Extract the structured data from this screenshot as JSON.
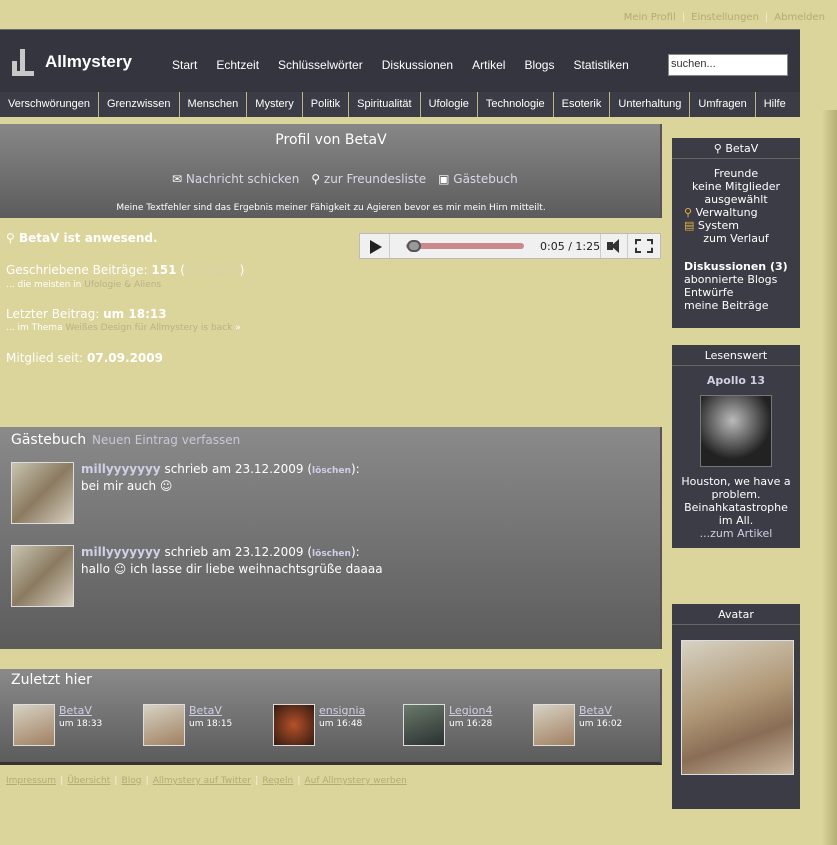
{
  "toplinks": [
    "Mein Profil",
    "Einstellungen",
    "Abmelden"
  ],
  "brand": "Allmystery",
  "mainnav": [
    "Start",
    "Echtzeit",
    "Schlüsselwörter",
    "Diskussionen",
    "Artikel",
    "Blogs",
    "Statistiken"
  ],
  "search": {
    "value": "suchen..."
  },
  "catnav": [
    "Verschwörungen",
    "Grenzwissen",
    "Menschen",
    "Mystery",
    "Politik",
    "Spiritualität",
    "Ufologie",
    "Technologie",
    "Esoterik",
    "Unterhaltung",
    "Umfragen",
    "Hilfe"
  ],
  "profile": {
    "title": "Profil von BetaV",
    "send": "Nachricht schicken",
    "friends": "zur Freundesliste",
    "guestbook": "Gästebuch",
    "motto": "Meine Textfehler sind das Ergebnis meiner Fähigkeit zu Agieren bevor es mir mein Hirn mitteilt."
  },
  "online": "BetaV ist anwesend.",
  "player": {
    "time": "0:05 / 1:25",
    "progress": 0.06
  },
  "stats": {
    "posts_label": "Geschriebene Beiträge:",
    "posts": "151",
    "show": "anzeigen",
    "posts_sub": "... die meisten in",
    "posts_sub_link": "Ufologie & Aliens",
    "last_label": "Letzter Beitrag:",
    "last": "um 18:13",
    "last_sub": "... im Thema",
    "last_sub_link": "Weißes Design für Allmystery is back",
    "member_label": "Mitglied seit:",
    "member": "07.09.2009"
  },
  "guestbook": {
    "title": "Gästebuch",
    "new": "Neuen Eintrag verfassen",
    "entries": [
      {
        "user": "millyyyyyyy",
        "wrote": "schrieb am 23.12.2009 (",
        "del": "löschen",
        "end": "):",
        "msg": "bei mir auch ☺"
      },
      {
        "user": "millyyyyyyy",
        "wrote": "schrieb am 23.12.2009 (",
        "del": "löschen",
        "end": "):",
        "msg": "hallo ☺ ich lasse dir liebe weihnachtsgrüße daaaa"
      }
    ]
  },
  "last": {
    "title": "Zuletzt hier",
    "visitors": [
      {
        "name": "BetaV",
        "time": "um 18:33"
      },
      {
        "name": "BetaV",
        "time": "um 18:15"
      },
      {
        "name": "ensignia",
        "time": "um 16:48"
      },
      {
        "name": "Legion4",
        "time": "um 16:28"
      },
      {
        "name": "BetaV",
        "time": "um 16:02"
      }
    ]
  },
  "footer": [
    "Impressum",
    "Übersicht",
    "Blog",
    "Allmystery auf Twitter",
    "Regeln",
    "Auf Allmystery werben"
  ],
  "userbox": {
    "title": "BetaV",
    "friends": "Freunde",
    "nofriends": "keine Mitglieder ausgewählt",
    "admin": "Verwaltung",
    "system": "System",
    "history": "zum Verlauf",
    "disc": "Diskussionen (3)",
    "blogs": "abonnierte Blogs",
    "drafts": "Entwürfe",
    "posts": "meine Beiträge"
  },
  "lesenswert": {
    "title": "Lesenswert",
    "article": "Apollo 13",
    "text": "Houston, we have a problem. Beinahkatastrophe im All.",
    "more": "...zum Artikel"
  },
  "avatar": {
    "title": "Avatar"
  }
}
